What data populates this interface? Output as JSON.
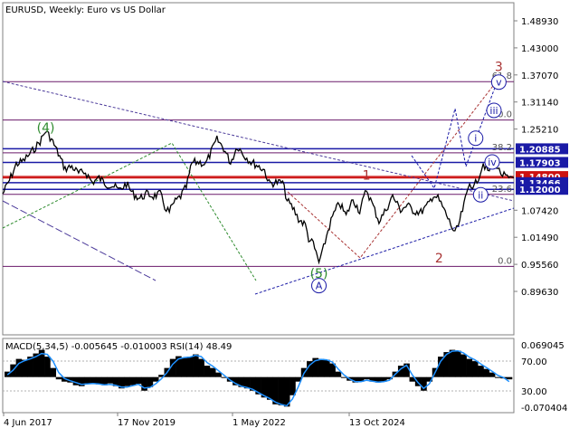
{
  "header": {
    "symbol": "EURUSD",
    "timeframe": "Weekly",
    "description": "Euro vs US Dollar"
  },
  "colors": {
    "price_line": "#000000",
    "blue_level": "#1a1aa6",
    "red_level": "#cc1111",
    "dark_red_level": "#8b1a1a",
    "fib_level": "#6a1a6a",
    "wave_green": "#2e8b2e",
    "wave_navy": "#1a1aa6",
    "wave_red": "#a83232",
    "trend_purple": "#4b3a9a",
    "macd_hist": "#000000",
    "macd_signal": "#1e90ff",
    "frame": "#808080"
  },
  "chart_data": [
    {
      "type": "line",
      "panel": "price",
      "ylim": [
        0.925,
        1.52
      ],
      "y_ticks": [
        "1.48930",
        "1.43000",
        "1.37070",
        "1.31140",
        "1.25210",
        "1.07420",
        "1.01490",
        "0.95560",
        "0.89630"
      ],
      "x_ticks": [
        "4 Jun 2017",
        "17 Nov 2019",
        "1 May 2022",
        "13 Oct 2024"
      ],
      "x_range": [
        "2017-05-21",
        "2026-01-11"
      ],
      "price_labels": [
        {
          "text": "1.20885",
          "value": 1.20885,
          "color": "#1a1aa6"
        },
        {
          "text": "1.17903",
          "value": 1.17903,
          "color": "#1a1aa6"
        },
        {
          "text": "1.14800",
          "value": 1.148,
          "color": "#cc1111"
        },
        {
          "text": "1.13466",
          "value": 1.13466,
          "color": "#1a1aa6"
        },
        {
          "text": "1.12000",
          "value": 1.12,
          "color": "#1a1aa6"
        }
      ],
      "fib_levels": [
        {
          "label": "61.8",
          "value": 1.356
        },
        {
          "label": "50.0",
          "value": 1.272
        },
        {
          "label": "38.2",
          "value": 1.2
        },
        {
          "label": "23.6",
          "value": 1.109
        },
        {
          "label": "0.0",
          "value": 0.951
        }
      ],
      "wave_labels": [
        {
          "text": "(4)",
          "date": "2018-02-11",
          "price": 1.255,
          "style": "green"
        },
        {
          "text": "(5)",
          "date": "2022-09-25",
          "price": 0.936,
          "style": "green"
        },
        {
          "text": "A",
          "date": "2022-09-25",
          "price": 0.909,
          "style": "navy-circle"
        },
        {
          "text": "1",
          "date": "2023-07-16",
          "price": 1.151,
          "style": "red"
        },
        {
          "text": "2",
          "date": "2024-10-06",
          "price": 0.97,
          "style": "red"
        },
        {
          "text": "3",
          "date": "2025-10-10",
          "price": 1.389,
          "style": "red"
        },
        {
          "text": "i",
          "date": "2025-05-20",
          "price": 1.232,
          "style": "navy-circle"
        },
        {
          "text": "ii",
          "date": "2025-06-20",
          "price": 1.108,
          "style": "navy-circle"
        },
        {
          "text": "iii",
          "date": "2025-09-10",
          "price": 1.293,
          "style": "navy-circle"
        },
        {
          "text": "iv",
          "date": "2025-08-30",
          "price": 1.18,
          "style": "navy-circle"
        },
        {
          "text": "v",
          "date": "2025-10-10",
          "price": 1.355,
          "style": "navy-circle"
        }
      ],
      "price_series": [
        {
          "date": "2017-05-21",
          "price": 1.11
        },
        {
          "date": "2017-07-02",
          "price": 1.14
        },
        {
          "date": "2017-08-13",
          "price": 1.175
        },
        {
          "date": "2017-09-24",
          "price": 1.182
        },
        {
          "date": "2017-11-12",
          "price": 1.2
        },
        {
          "date": "2018-01-07",
          "price": 1.225
        },
        {
          "date": "2018-02-11",
          "price": 1.248
        },
        {
          "date": "2018-03-18",
          "price": 1.23
        },
        {
          "date": "2018-04-29",
          "price": 1.198
        },
        {
          "date": "2018-06-10",
          "price": 1.165
        },
        {
          "date": "2018-07-22",
          "price": 1.17
        },
        {
          "date": "2018-09-02",
          "price": 1.155
        },
        {
          "date": "2018-10-14",
          "price": 1.158
        },
        {
          "date": "2018-11-25",
          "price": 1.135
        },
        {
          "date": "2019-01-06",
          "price": 1.145
        },
        {
          "date": "2019-02-17",
          "price": 1.132
        },
        {
          "date": "2019-03-31",
          "price": 1.128
        },
        {
          "date": "2019-05-12",
          "price": 1.118
        },
        {
          "date": "2019-06-23",
          "price": 1.132
        },
        {
          "date": "2019-08-04",
          "price": 1.11
        },
        {
          "date": "2019-09-15",
          "price": 1.1
        },
        {
          "date": "2019-10-27",
          "price": 1.11
        },
        {
          "date": "2019-12-08",
          "price": 1.105
        },
        {
          "date": "2020-01-19",
          "price": 1.11
        },
        {
          "date": "2020-02-16",
          "price": 1.082
        },
        {
          "date": "2020-03-15",
          "price": 1.07
        },
        {
          "date": "2020-04-12",
          "price": 1.09
        },
        {
          "date": "2020-05-24",
          "price": 1.105
        },
        {
          "date": "2020-06-28",
          "price": 1.125
        },
        {
          "date": "2020-08-02",
          "price": 1.178
        },
        {
          "date": "2020-09-13",
          "price": 1.18
        },
        {
          "date": "2020-10-25",
          "price": 1.175
        },
        {
          "date": "2020-12-06",
          "price": 1.208
        },
        {
          "date": "2021-01-03",
          "price": 1.229
        },
        {
          "date": "2021-02-14",
          "price": 1.21
        },
        {
          "date": "2021-03-28",
          "price": 1.178
        },
        {
          "date": "2021-05-09",
          "price": 1.215
        },
        {
          "date": "2021-06-20",
          "price": 1.195
        },
        {
          "date": "2021-08-01",
          "price": 1.18
        },
        {
          "date": "2021-09-12",
          "price": 1.172
        },
        {
          "date": "2021-10-24",
          "price": 1.162
        },
        {
          "date": "2021-11-21",
          "price": 1.133
        },
        {
          "date": "2022-01-02",
          "price": 1.135
        },
        {
          "date": "2022-02-13",
          "price": 1.135
        },
        {
          "date": "2022-03-13",
          "price": 1.095
        },
        {
          "date": "2022-04-24",
          "price": 1.075
        },
        {
          "date": "2022-05-22",
          "price": 1.055
        },
        {
          "date": "2022-07-03",
          "price": 1.042
        },
        {
          "date": "2022-07-24",
          "price": 1.012
        },
        {
          "date": "2022-08-21",
          "price": 1.0
        },
        {
          "date": "2022-09-25",
          "price": 0.96
        },
        {
          "date": "2022-10-16",
          "price": 0.98
        },
        {
          "date": "2022-11-20",
          "price": 1.03
        },
        {
          "date": "2022-12-18",
          "price": 1.06
        },
        {
          "date": "2023-01-29",
          "price": 1.09
        },
        {
          "date": "2023-03-12",
          "price": 1.062
        },
        {
          "date": "2023-04-23",
          "price": 1.099
        },
        {
          "date": "2023-06-04",
          "price": 1.072
        },
        {
          "date": "2023-07-16",
          "price": 1.12
        },
        {
          "date": "2023-08-27",
          "price": 1.082
        },
        {
          "date": "2023-10-01",
          "price": 1.05
        },
        {
          "date": "2023-11-05",
          "price": 1.07
        },
        {
          "date": "2023-12-24",
          "price": 1.105
        },
        {
          "date": "2024-02-11",
          "price": 1.075
        },
        {
          "date": "2024-03-24",
          "price": 1.085
        },
        {
          "date": "2024-05-05",
          "price": 1.072
        },
        {
          "date": "2024-06-16",
          "price": 1.07
        },
        {
          "date": "2024-07-28",
          "price": 1.085
        },
        {
          "date": "2024-09-01",
          "price": 1.108
        },
        {
          "date": "2024-09-29",
          "price": 1.1
        },
        {
          "date": "2024-10-27",
          "price": 1.082
        },
        {
          "date": "2024-12-08",
          "price": 1.05
        },
        {
          "date": "2025-01-12",
          "price": 1.022
        },
        {
          "date": "2025-02-02",
          "price": 1.04
        },
        {
          "date": "2025-03-09",
          "price": 1.085
        },
        {
          "date": "2025-04-13",
          "price": 1.135
        },
        {
          "date": "2025-05-11",
          "price": 1.125
        },
        {
          "date": "2025-06-15",
          "price": 1.155
        },
        {
          "date": "2025-07-06",
          "price": 1.178
        },
        {
          "date": "2025-08-03",
          "price": 1.158
        },
        {
          "date": "2025-08-31",
          "price": 1.172
        },
        {
          "date": "2025-09-14",
          "price": 1.182
        },
        {
          "date": "2025-10-12",
          "price": 1.16
        },
        {
          "date": "2025-11-02",
          "price": 1.152
        },
        {
          "date": "2025-11-30",
          "price": 1.145
        },
        {
          "date": "2025-12-21",
          "price": 1.14
        },
        {
          "date": "2026-01-11",
          "price": 1.145
        }
      ]
    },
    {
      "type": "bar",
      "panel": "indicator",
      "label": "MACD(5,34,5) -0.005645 -0.010003 RSI(14) 48.49",
      "ylim": [
        -0.0704,
        0.0691
      ],
      "y_ticks": [
        "0.069045",
        "70.00",
        "30.00",
        "-0.070404"
      ],
      "series": [
        {
          "name": "MACD",
          "values": [
            0.012,
            0.028,
            0.04,
            0.038,
            0.045,
            0.052,
            0.06,
            0.045,
            0.02,
            -0.005,
            -0.01,
            -0.012,
            -0.018,
            -0.02,
            -0.014,
            -0.015,
            -0.016,
            -0.018,
            -0.014,
            -0.02,
            -0.025,
            -0.02,
            -0.018,
            -0.015,
            -0.03,
            -0.022,
            -0.01,
            0.005,
            0.02,
            0.04,
            0.046,
            0.042,
            0.045,
            0.05,
            0.04,
            0.025,
            0.02,
            0.01,
            0.0,
            -0.01,
            -0.018,
            -0.022,
            -0.025,
            -0.03,
            -0.038,
            -0.045,
            -0.05,
            -0.06,
            -0.062,
            -0.065,
            -0.04,
            -0.01,
            0.02,
            0.035,
            0.042,
            0.04,
            0.038,
            0.03,
            0.012,
            0.0,
            -0.008,
            -0.012,
            -0.01,
            -0.005,
            -0.01,
            -0.012,
            -0.01,
            -0.005,
            0.012,
            0.025,
            0.03,
            -0.01,
            -0.02,
            -0.03,
            -0.01,
            0.02,
            0.045,
            0.055,
            0.06,
            0.058,
            0.05,
            0.04,
            0.035,
            0.025,
            0.018,
            0.01,
            0.0,
            -0.003,
            -0.005
          ]
        },
        {
          "name": "Signal",
          "values": [
            0.005,
            0.015,
            0.03,
            0.036,
            0.04,
            0.045,
            0.052,
            0.05,
            0.035,
            0.01,
            -0.003,
            -0.008,
            -0.012,
            -0.016,
            -0.015,
            -0.014,
            -0.015,
            -0.017,
            -0.016,
            -0.018,
            -0.022,
            -0.022,
            -0.019,
            -0.016,
            -0.024,
            -0.023,
            -0.015,
            -0.004,
            0.01,
            0.028,
            0.04,
            0.043,
            0.044,
            0.048,
            0.045,
            0.032,
            0.024,
            0.014,
            0.004,
            -0.006,
            -0.014,
            -0.02,
            -0.023,
            -0.027,
            -0.034,
            -0.041,
            -0.047,
            -0.055,
            -0.06,
            -0.063,
            -0.048,
            -0.022,
            0.008,
            0.026,
            0.036,
            0.039,
            0.038,
            0.033,
            0.018,
            0.005,
            -0.004,
            -0.01,
            -0.01,
            -0.007,
            -0.009,
            -0.011,
            -0.01,
            -0.007,
            0.006,
            0.018,
            0.026,
            0.005,
            -0.012,
            -0.025,
            -0.015,
            0.01,
            0.035,
            0.05,
            0.057,
            0.058,
            0.053,
            0.044,
            0.038,
            0.029,
            0.021,
            0.013,
            0.004,
            -0.001,
            -0.01
          ]
        }
      ]
    }
  ]
}
